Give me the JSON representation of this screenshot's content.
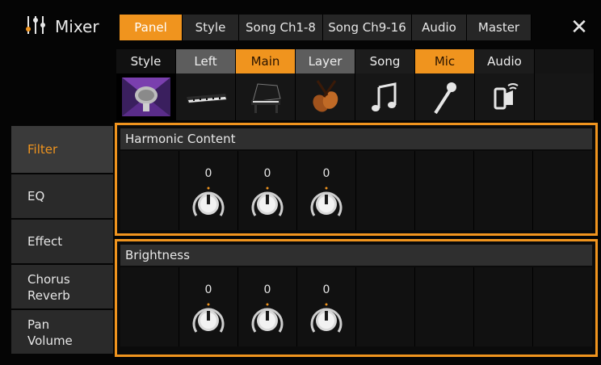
{
  "title": {
    "text": "Mixer",
    "icon": "mixer-sliders-icon"
  },
  "top_tabs": [
    {
      "label": "Panel",
      "active": true
    },
    {
      "label": "Style",
      "active": false
    },
    {
      "label": "Song Ch1-8",
      "active": false
    },
    {
      "label": "Song Ch9-16",
      "active": false
    },
    {
      "label": "Audio",
      "active": false
    },
    {
      "label": "Master",
      "active": false
    }
  ],
  "close_label": "✕",
  "parts": {
    "labels": [
      "Style",
      "Left",
      "Main",
      "Layer",
      "Song",
      "Mic",
      "Audio",
      ""
    ],
    "icons": [
      "microphone-stage-icon",
      "keyboard-icon",
      "grand-piano-icon",
      "violins-icon",
      "music-note-icon",
      "microphone-icon",
      "audio-device-icon"
    ]
  },
  "categories": [
    {
      "label": "Filter",
      "active": true
    },
    {
      "label": "EQ",
      "active": false
    },
    {
      "label": "Effect",
      "active": false
    },
    {
      "label": "Chorus\nReverb",
      "active": false
    },
    {
      "label": "Pan\nVolume",
      "active": false
    }
  ],
  "sections": [
    {
      "title": "Harmonic Content",
      "values": [
        "0",
        "0",
        "0"
      ]
    },
    {
      "title": "Brightness",
      "values": [
        "0",
        "0",
        "0"
      ]
    }
  ],
  "colors": {
    "accent": "#f0941e",
    "active_part_gray": "#5d5d5d",
    "panel_bg": "#111111"
  }
}
